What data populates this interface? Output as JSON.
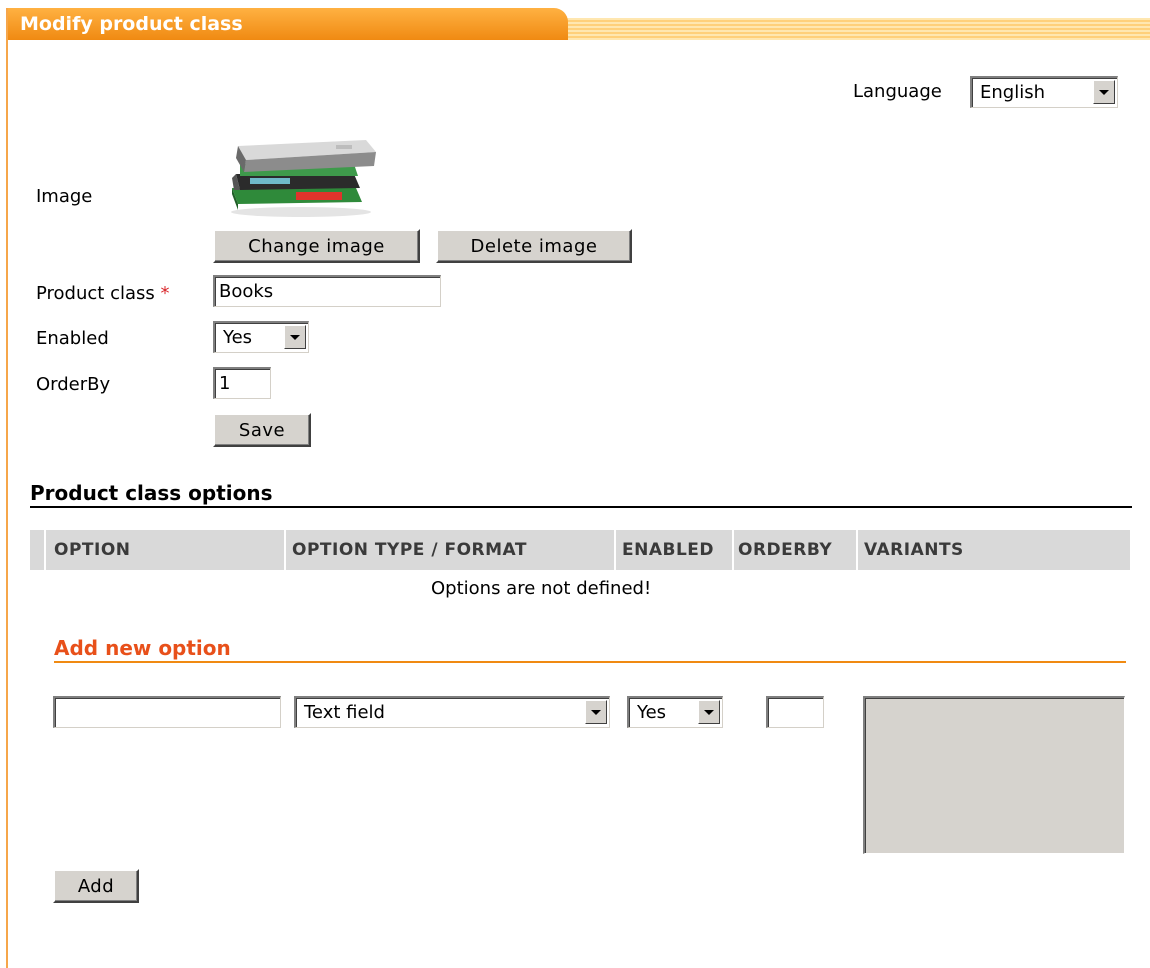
{
  "panel": {
    "title": "Modify product class"
  },
  "language": {
    "label": "Language",
    "selected": "English"
  },
  "form": {
    "image_label": "Image",
    "change_image_label": "Change image",
    "delete_image_label": "Delete image",
    "product_class_label": "Product class",
    "required_mark": "*",
    "product_class_value": "Books",
    "enabled_label": "Enabled",
    "enabled_value": "Yes",
    "orderby_label": "OrderBy",
    "orderby_value": "1",
    "save_label": "Save"
  },
  "options": {
    "section_title": "Product class options",
    "columns": [
      "OPTION",
      "OPTION TYPE / FORMAT",
      "ENABLED",
      "ORDERBY",
      "VARIANTS"
    ],
    "empty_message": "Options are not defined!"
  },
  "add_option": {
    "title": "Add new option",
    "name_value": "",
    "type_value": "Text field",
    "enabled_value": "Yes",
    "orderby_value": "",
    "add_label": "Add"
  },
  "colors": {
    "accent": "#f08a12",
    "accent_text": "#e8501a",
    "header_bg": "#d9d9d9"
  }
}
